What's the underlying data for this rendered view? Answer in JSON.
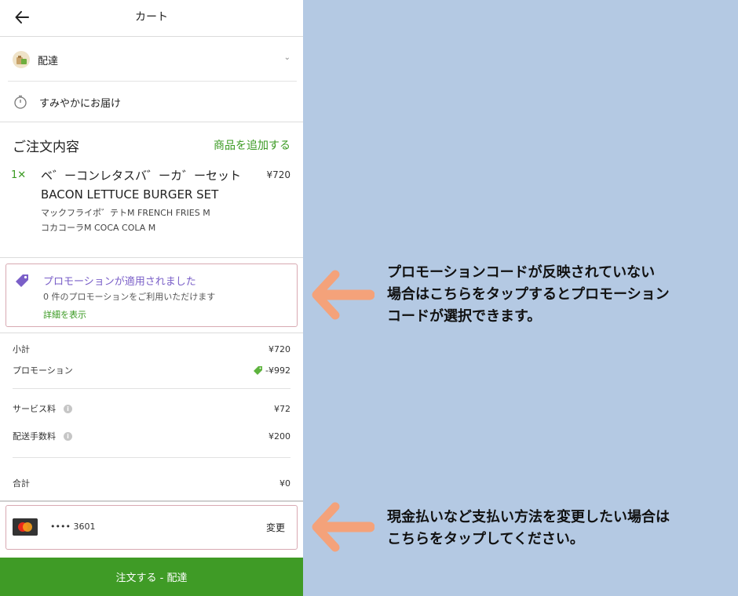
{
  "header": {
    "title": "カート"
  },
  "delivery": {
    "label": "配達"
  },
  "timing": {
    "label": "すみやかにお届け"
  },
  "order": {
    "heading": "ご注文内容",
    "add_label": "商品を追加する",
    "item": {
      "qty": "1✕",
      "name": "ベ゛ーコンレタスバ゛ーカ゛ーセット BACON LETTUCE BURGER SET",
      "price": "¥720",
      "options": [
        "マックフライポ゛テトM FRENCH FRIES M",
        "コカコーラM COCA COLA M"
      ]
    }
  },
  "promo": {
    "title": "プロモーションが適用されました",
    "subtitle": "0 件のプロモーションをご利用いただけます",
    "details": "詳細を表示"
  },
  "summary": {
    "subtotal_label": "小計",
    "subtotal": "¥720",
    "promotion_label": "プロモーション",
    "promotion": "-¥992",
    "service_label": "サービス料",
    "service": "¥72",
    "delivery_fee_label": "配送手数料",
    "delivery_fee": "¥200",
    "total_label": "合計",
    "total": "¥0"
  },
  "payment": {
    "card_number": "•••• 3601",
    "change_label": "変更"
  },
  "cta": {
    "label": "注文する - 配達"
  },
  "notes": {
    "promo_line1": "プロモーションコードが反映されていない",
    "promo_line2": "場合はこちらをタップするとプロモーション",
    "promo_line3": "コードが選択できます。",
    "pay_line1": "現金払いなど支払い方法を変更したい場合は",
    "pay_line2": "こちらをタップしてください。"
  },
  "colors": {
    "accent_green": "#3f9b26",
    "promo_purple": "#7a5fc8",
    "arrow_orange": "#f4a27a",
    "background": "#b4c9e3"
  }
}
